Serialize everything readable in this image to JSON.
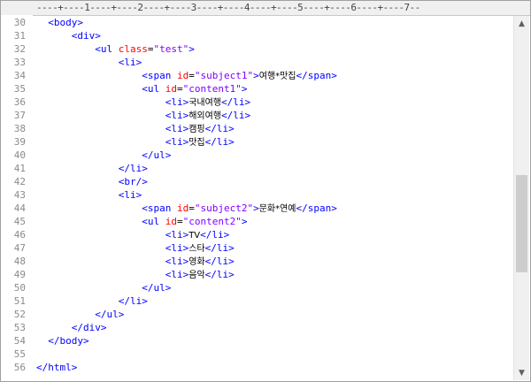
{
  "ruler": "----+----1----+----2----+----3----+----4----+----5----+----6----+----7--",
  "lines": [
    {
      "n": "30",
      "indent": "  ",
      "parts": [
        [
          "tag",
          "<body>"
        ]
      ]
    },
    {
      "n": "31",
      "indent": "      ",
      "parts": [
        [
          "tag",
          "<div>"
        ]
      ]
    },
    {
      "n": "32",
      "indent": "          ",
      "parts": [
        [
          "tag",
          "<ul "
        ],
        [
          "attr",
          "class"
        ],
        [
          "eq",
          "="
        ],
        [
          "val",
          "\"test\""
        ],
        [
          "tag",
          ">"
        ]
      ]
    },
    {
      "n": "33",
      "indent": "              ",
      "parts": [
        [
          "tag",
          "<li>"
        ]
      ]
    },
    {
      "n": "34",
      "indent": "                  ",
      "parts": [
        [
          "tag",
          "<span "
        ],
        [
          "attr",
          "id"
        ],
        [
          "eq",
          "="
        ],
        [
          "val",
          "\"subject1\""
        ],
        [
          "tag",
          ">"
        ],
        [
          "txt",
          "여행*맛집"
        ],
        [
          "tag",
          "</span>"
        ]
      ]
    },
    {
      "n": "35",
      "indent": "                  ",
      "parts": [
        [
          "tag",
          "<ul "
        ],
        [
          "attr",
          "id"
        ],
        [
          "eq",
          "="
        ],
        [
          "val",
          "\"content1\""
        ],
        [
          "tag",
          ">"
        ]
      ]
    },
    {
      "n": "36",
      "indent": "                      ",
      "parts": [
        [
          "tag",
          "<li>"
        ],
        [
          "txt",
          "국내여행"
        ],
        [
          "tag",
          "</li>"
        ]
      ]
    },
    {
      "n": "37",
      "indent": "                      ",
      "parts": [
        [
          "tag",
          "<li>"
        ],
        [
          "txt",
          "해외여행"
        ],
        [
          "tag",
          "</li>"
        ]
      ]
    },
    {
      "n": "38",
      "indent": "                      ",
      "parts": [
        [
          "tag",
          "<li>"
        ],
        [
          "txt",
          "캠핑"
        ],
        [
          "tag",
          "</li>"
        ]
      ]
    },
    {
      "n": "39",
      "indent": "                      ",
      "parts": [
        [
          "tag",
          "<li>"
        ],
        [
          "txt",
          "맛집"
        ],
        [
          "tag",
          "</li>"
        ]
      ]
    },
    {
      "n": "40",
      "indent": "                  ",
      "parts": [
        [
          "tag",
          "</ul>"
        ]
      ]
    },
    {
      "n": "41",
      "indent": "              ",
      "parts": [
        [
          "tag",
          "</li>"
        ]
      ]
    },
    {
      "n": "42",
      "indent": "              ",
      "parts": [
        [
          "tag",
          "<br/>"
        ]
      ]
    },
    {
      "n": "43",
      "indent": "              ",
      "parts": [
        [
          "tag",
          "<li>"
        ]
      ]
    },
    {
      "n": "44",
      "indent": "                  ",
      "parts": [
        [
          "tag",
          "<span "
        ],
        [
          "attr",
          "id"
        ],
        [
          "eq",
          "="
        ],
        [
          "val",
          "\"subject2\""
        ],
        [
          "tag",
          ">"
        ],
        [
          "txt",
          "문화*연예"
        ],
        [
          "tag",
          "</span>"
        ]
      ]
    },
    {
      "n": "45",
      "indent": "                  ",
      "parts": [
        [
          "tag",
          "<ul "
        ],
        [
          "attr",
          "id"
        ],
        [
          "eq",
          "="
        ],
        [
          "val",
          "\"content2\""
        ],
        [
          "tag",
          ">"
        ]
      ]
    },
    {
      "n": "46",
      "indent": "                      ",
      "parts": [
        [
          "tag",
          "<li>"
        ],
        [
          "txt",
          "TV"
        ],
        [
          "tag",
          "</li>"
        ]
      ]
    },
    {
      "n": "47",
      "indent": "                      ",
      "parts": [
        [
          "tag",
          "<li>"
        ],
        [
          "txt",
          "스타"
        ],
        [
          "tag",
          "</li>"
        ]
      ]
    },
    {
      "n": "48",
      "indent": "                      ",
      "parts": [
        [
          "tag",
          "<li>"
        ],
        [
          "txt",
          "영화"
        ],
        [
          "tag",
          "</li>"
        ]
      ]
    },
    {
      "n": "49",
      "indent": "                      ",
      "parts": [
        [
          "tag",
          "<li>"
        ],
        [
          "txt",
          "음악"
        ],
        [
          "tag",
          "</li>"
        ]
      ]
    },
    {
      "n": "50",
      "indent": "                  ",
      "parts": [
        [
          "tag",
          "</ul>"
        ]
      ]
    },
    {
      "n": "51",
      "indent": "              ",
      "parts": [
        [
          "tag",
          "</li>"
        ]
      ]
    },
    {
      "n": "52",
      "indent": "          ",
      "parts": [
        [
          "tag",
          "</ul>"
        ]
      ]
    },
    {
      "n": "53",
      "indent": "      ",
      "parts": [
        [
          "tag",
          "</div>"
        ]
      ]
    },
    {
      "n": "54",
      "indent": "  ",
      "parts": [
        [
          "tag",
          "</body>"
        ]
      ]
    },
    {
      "n": "55",
      "indent": "",
      "parts": []
    },
    {
      "n": "56",
      "indent": "",
      "parts": [
        [
          "tag",
          "</html>"
        ]
      ]
    }
  ],
  "icons": {
    "scroll_up": "triangle-up",
    "scroll_down": "triangle-down"
  }
}
